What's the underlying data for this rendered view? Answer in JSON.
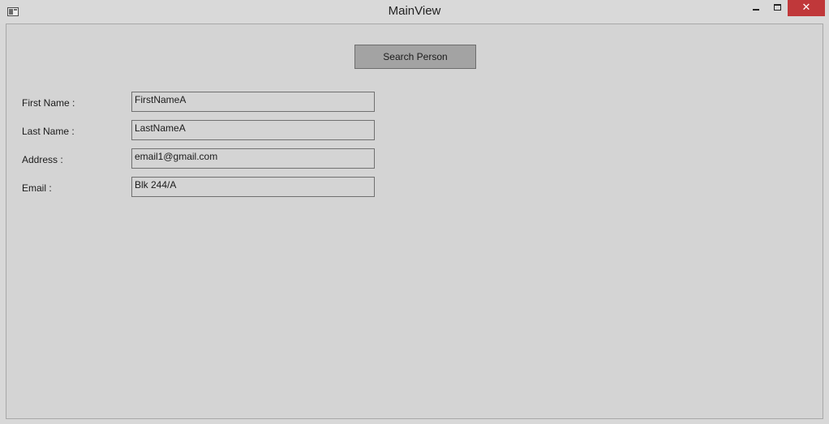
{
  "window": {
    "title": "MainView",
    "app_icon": "window-app-icon",
    "controls": {
      "minimize_icon": "minimize-icon",
      "maximize_icon": "maximize-icon",
      "close_icon": "close-icon",
      "close_glyph": "✕",
      "close_color": "#c0383a"
    }
  },
  "main": {
    "search_button_label": "Search Person",
    "fields": [
      {
        "label": "First Name :",
        "value": "FirstNameA"
      },
      {
        "label": "Last Name :",
        "value": "LastNameA"
      },
      {
        "label": "Address :",
        "value": "email1@gmail.com"
      },
      {
        "label": "Email :",
        "value": "Blk 244/A"
      }
    ]
  }
}
